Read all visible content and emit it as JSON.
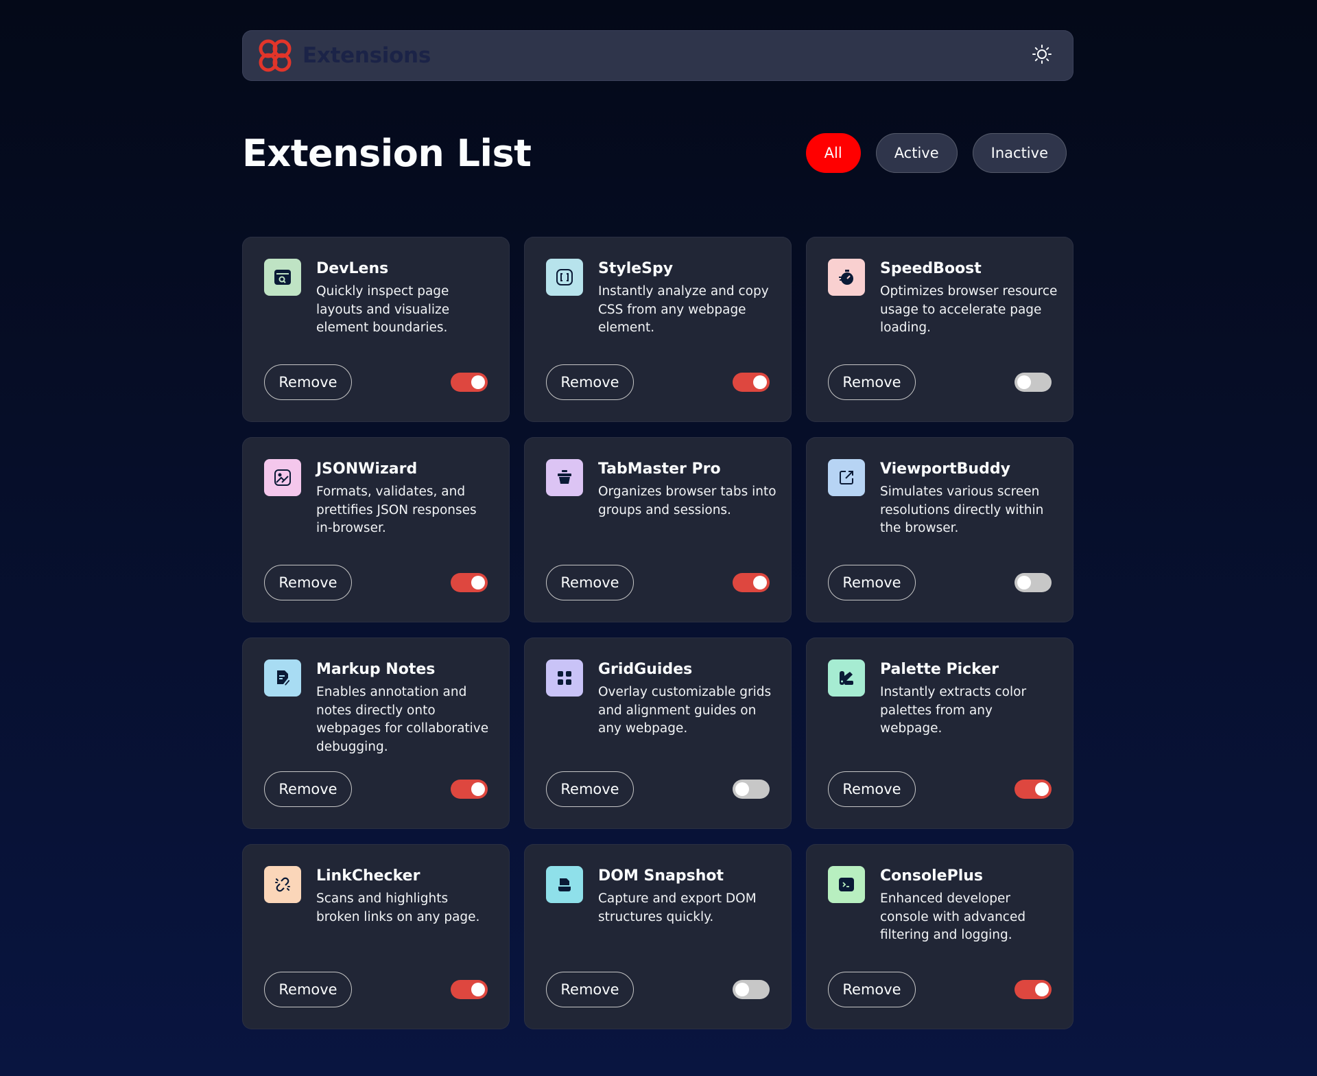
{
  "header": {
    "brand": "Extensions",
    "logo_icon": "extensions-logo-icon",
    "theme_icon": "sun-icon",
    "accent": "#ff0000"
  },
  "main": {
    "title": "Extension List",
    "filters": [
      "All",
      "Active",
      "Inactive"
    ],
    "selected_filter": "All"
  },
  "extensions": [
    {
      "name": "DevLens",
      "desc": "Quickly inspect page layouts and visualize element boundaries.",
      "icon": "inspect-window-icon",
      "icon_bg": "#bfe3c4",
      "active": true
    },
    {
      "name": "StyleSpy",
      "desc": "Instantly analyze and copy CSS from any webpage element.",
      "icon": "code-brackets-icon",
      "icon_bg": "#b7e3ec",
      "active": true
    },
    {
      "name": "SpeedBoost",
      "desc": "Optimizes browser resource usage to accelerate page loading.",
      "icon": "stopwatch-icon",
      "icon_bg": "#f9d0d0",
      "active": false
    },
    {
      "name": "JSONWizard",
      "desc": "Formats, validates, and prettifies JSON responses in-browser.",
      "icon": "wand-image-icon",
      "icon_bg": "#f4c7ec",
      "active": true
    },
    {
      "name": "TabMaster Pro",
      "desc": "Organizes browser tabs into groups and sessions.",
      "icon": "pot-icon",
      "icon_bg": "#dcc4f4",
      "active": true
    },
    {
      "name": "ViewportBuddy",
      "desc": "Simulates various screen resolutions directly within the browser.",
      "icon": "external-window-icon",
      "icon_bg": "#b7d4f4",
      "active": false
    },
    {
      "name": "Markup Notes",
      "desc": "Enables annotation and notes directly onto webpages for collaborative debugging.",
      "icon": "note-pencil-icon",
      "icon_bg": "#a8dcf3",
      "active": true
    },
    {
      "name": "GridGuides",
      "desc": "Overlay customizable grids and alignment guides on any webpage.",
      "icon": "grid-icon",
      "icon_bg": "#c9c3f7",
      "active": false
    },
    {
      "name": "Palette Picker",
      "desc": "Instantly extracts color palettes from any webpage.",
      "icon": "palette-icon",
      "icon_bg": "#a6ecd2",
      "active": true
    },
    {
      "name": "LinkChecker",
      "desc": "Scans and highlights broken links on any page.",
      "icon": "broken-link-icon",
      "icon_bg": "#fbd6b9",
      "active": true
    },
    {
      "name": "DOM Snapshot",
      "desc": "Capture and export DOM structures quickly.",
      "icon": "snapshot-icon",
      "icon_bg": "#8fe0ea",
      "active": false
    },
    {
      "name": "ConsolePlus",
      "desc": "Enhanced developer console with advanced filtering and logging.",
      "icon": "terminal-icon",
      "icon_bg": "#b8efc0",
      "active": true
    }
  ],
  "labels": {
    "remove": "Remove"
  },
  "colors": {
    "toggle_on": "#de473f",
    "toggle_off": "#c7c7c7",
    "card_bg": "#212636"
  }
}
